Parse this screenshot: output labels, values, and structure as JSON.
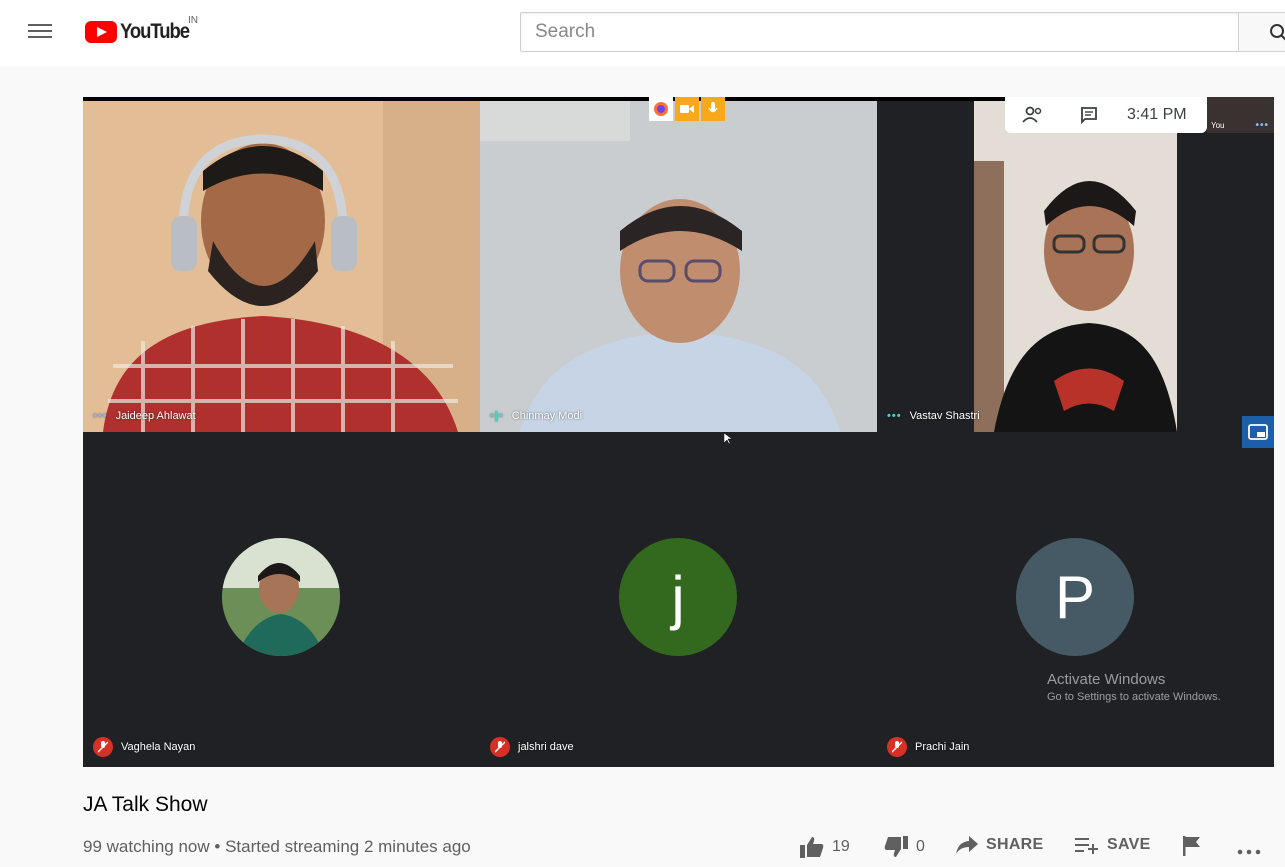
{
  "masthead": {
    "logo_text": "YouTube",
    "region": "IN",
    "search_placeholder": "Search"
  },
  "meeting": {
    "time": "3:41 PM",
    "self_label": "You",
    "participants_count_icon": "people-icon",
    "chat_icon": "chat-icon",
    "participants": [
      {
        "name": "Jaideep Ahlawat",
        "status": "speaking-dots"
      },
      {
        "name": "Chinmay Modi",
        "status": "speaking-wave"
      },
      {
        "name": "Vastav Shastri",
        "status": "speaking-dots"
      },
      {
        "name": "Vaghela Nayan",
        "status": "muted",
        "avatar": "photo"
      },
      {
        "name": "jalshri dave",
        "status": "muted",
        "avatar_letter": "j",
        "avatar_color": "#33691e"
      },
      {
        "name": "Prachi Jain",
        "status": "muted",
        "avatar_letter": "P",
        "avatar_color": "#455a64"
      }
    ],
    "watermark_line1": "Activate Windows",
    "watermark_line2": "Go to Settings to activate Windows."
  },
  "video": {
    "title": "JA Talk Show",
    "watching": "99 watching now",
    "separator": "•",
    "started": "Started streaming 2 minutes ago",
    "likes": "19",
    "dislikes": "0",
    "share_label": "SHARE",
    "save_label": "SAVE"
  },
  "colors": {
    "brand_red": "#ff0000",
    "meet_dark": "#202124",
    "meet_blue": "#8ab4f8",
    "mute_red": "#d93025"
  }
}
